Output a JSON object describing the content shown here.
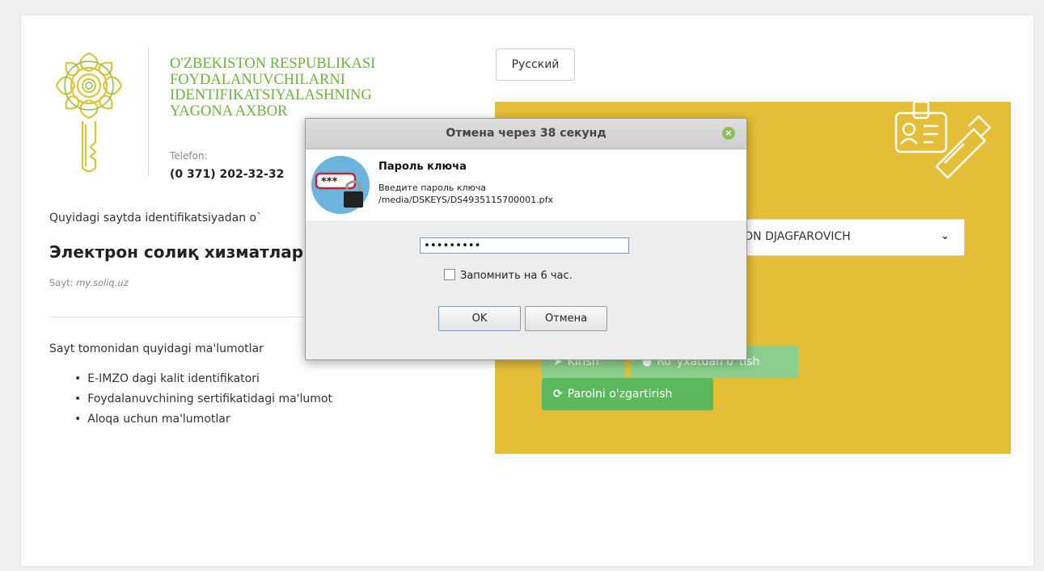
{
  "header": {
    "org_line1": "O'ZBEKISTON RESPUBLIKASI",
    "org_line2": "FOYDALANUVCHILARNI",
    "org_line3": "IDENTIFIKATSIYALASHNING",
    "org_line4": "YAGONA AXBOR",
    "phone_label": "Telefon:",
    "phone": "(0 371) 202-32-32"
  },
  "left": {
    "intro": "Quyidagi saytda identifikatsiyadan o`",
    "service_title": "Электрон солиқ хизматлар",
    "site_label": "Sayt:",
    "site_value": "my.soliq.uz",
    "info_text": "Sayt tomonidan quyidagi ma'lumotlar",
    "info_items": [
      "E-IMZO dagi kalit identifikatori",
      "Foydalanuvchining sertifikatidagi ma'lumot",
      "Aloqa uchun ma'lumotlar"
    ]
  },
  "language_button": "Русский",
  "panel": {
    "certificate_value": "JON DJAGFAROVICH",
    "login_label": "Kirish",
    "register_label": "Ro`yxatdan o`tish",
    "change_password_label": "Parolni o'zgartirish"
  },
  "dialog": {
    "title": "Отмена через 38 секунд",
    "heading": "Пароль ключа",
    "prompt": "Введите пароль ключа",
    "path": "/media/DSKEYS/DS4935115700001.pfx",
    "password_value": "•••••••••",
    "remember_label": "Запомнить на 6 час.",
    "remember_checked": false,
    "ok_label": "OK",
    "cancel_label": "Отмена",
    "key_icon_text": "***"
  },
  "colors": {
    "brand_green": "#6cb33e",
    "panel_yellow": "#e5be38",
    "button_green": "#5cb85c"
  }
}
